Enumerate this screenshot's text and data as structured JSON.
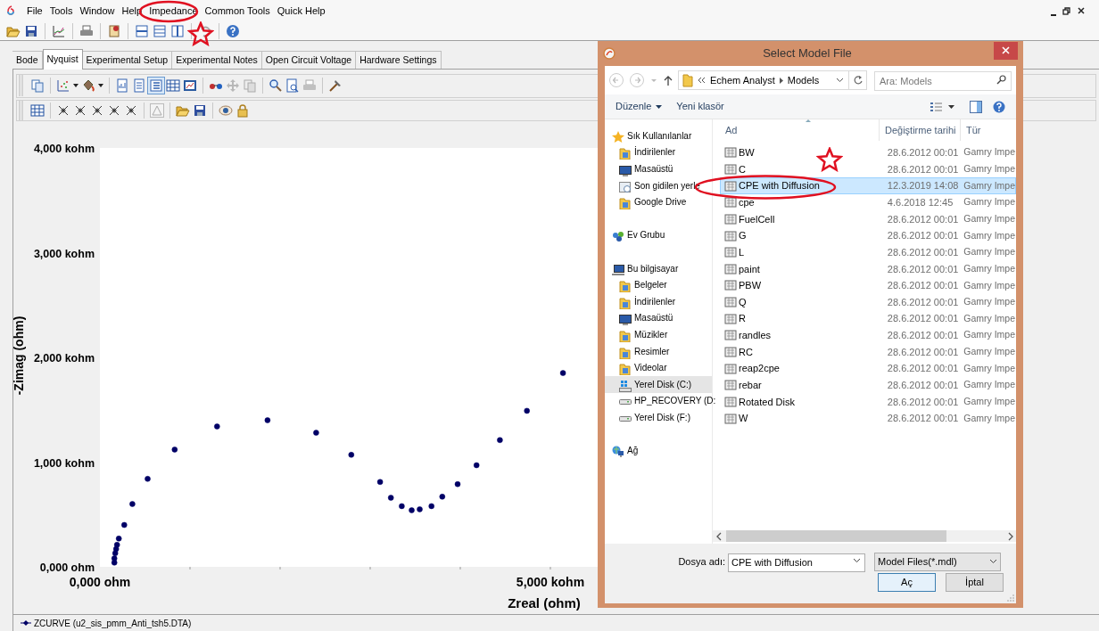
{
  "menu_bar": {
    "items": [
      "File",
      "Tools",
      "Window",
      "Help",
      "Impedance",
      "Common Tools",
      "Quick Help"
    ]
  },
  "tabs": [
    {
      "label": "Bode",
      "selected": false
    },
    {
      "label": "Nyquist",
      "selected": true
    },
    {
      "label": "Experimental Setup",
      "selected": false
    },
    {
      "label": "Experimental Notes",
      "selected": false
    },
    {
      "label": "Open Circuit Voltage",
      "selected": false
    },
    {
      "label": "Hardware Settings",
      "selected": false
    }
  ],
  "chart": {
    "chart_data": {
      "type": "scatter",
      "xlabel": "Zreal (ohm)",
      "ylabel": "-Zimag (ohm)",
      "x": [
        0.16,
        0.16,
        0.17,
        0.18,
        0.19,
        0.21,
        0.27,
        0.36,
        0.53,
        0.83,
        1.3,
        1.86,
        2.4,
        2.79,
        3.11,
        3.23,
        3.35,
        3.46,
        3.55,
        3.68,
        3.8,
        3.97,
        4.18,
        4.44,
        4.74,
        5.14
      ],
      "series": [
        {
          "name": "ZCURVE (u2_sis_pmm_Anti_tsh5.DTA)",
          "color": "#000066",
          "values": [
            0.04,
            0.08,
            0.13,
            0.17,
            0.21,
            0.27,
            0.4,
            0.6,
            0.84,
            1.12,
            1.34,
            1.4,
            1.28,
            1.07,
            0.81,
            0.66,
            0.58,
            0.54,
            0.55,
            0.58,
            0.67,
            0.79,
            0.97,
            1.21,
            1.49,
            1.85
          ]
        }
      ],
      "xlim": [
        0,
        10
      ],
      "ylim": [
        0,
        4
      ],
      "xticks": [
        {
          "value": 0,
          "label": "0,000 ohm"
        },
        {
          "value": 5,
          "label": "5,000 kohm"
        }
      ],
      "yticks": [
        {
          "value": 0,
          "label": "0,000 ohm"
        },
        {
          "value": 1,
          "label": "1,000 kohm"
        },
        {
          "value": 2,
          "label": "2,000 kohm"
        },
        {
          "value": 3,
          "label": "3,000 kohm"
        },
        {
          "value": 4,
          "label": "4,000 kohm"
        }
      ]
    }
  },
  "dialog": {
    "title": "Select Model File",
    "address": [
      "Echem Analyst",
      "Models"
    ],
    "search": {
      "placeholder": "Ara: Models"
    },
    "commands": [
      "Düzenle",
      "Yeni klasör"
    ],
    "nav": [
      {
        "label": "Sık Kullanılanlar",
        "kind": "favorites",
        "selected": false,
        "children": [
          {
            "label": "İndirilenler",
            "kind": "folder",
            "selected": false
          },
          {
            "label": "Masaüstü",
            "kind": "desktop",
            "selected": false
          },
          {
            "label": "Son gidilen yerle",
            "kind": "recent",
            "selected": false
          },
          {
            "label": "Google Drive",
            "kind": "folder",
            "selected": false
          }
        ]
      },
      {
        "label": "Ev Grubu",
        "kind": "homegroup",
        "selected": false
      },
      {
        "label": "Bu bilgisayar",
        "kind": "computer",
        "selected": false,
        "children": [
          {
            "label": "Belgeler",
            "kind": "folder",
            "selected": false
          },
          {
            "label": "İndirilenler",
            "kind": "folder",
            "selected": false
          },
          {
            "label": "Masaüstü",
            "kind": "desktop",
            "selected": false
          },
          {
            "label": "Müzikler",
            "kind": "folder",
            "selected": false
          },
          {
            "label": "Resimler",
            "kind": "folder",
            "selected": false
          },
          {
            "label": "Videolar",
            "kind": "folder",
            "selected": false
          },
          {
            "label": "Yerel Disk (C:)",
            "kind": "system-drive",
            "selected": true
          },
          {
            "label": "HP_RECOVERY (D:",
            "kind": "drive",
            "selected": false
          },
          {
            "label": "Yerel Disk (F:)",
            "kind": "drive",
            "selected": false
          }
        ]
      },
      {
        "label": "Ağ",
        "kind": "network",
        "selected": false
      }
    ],
    "columns": [
      "Ad",
      "Değiştirme tarihi",
      "Tür"
    ],
    "rows": [
      {
        "name": "BW",
        "modified": "28.6.2012 00:01",
        "type": "Gamry Impe",
        "selected": false
      },
      {
        "name": "C",
        "modified": "28.6.2012 00:01",
        "type": "Gamry Impe",
        "selected": false
      },
      {
        "name": "CPE with Diffusion",
        "modified": "12.3.2019 14:08",
        "type": "Gamry Impe",
        "selected": true
      },
      {
        "name": "cpe",
        "modified": "4.6.2018 12:45",
        "type": "Gamry Impe",
        "selected": false
      },
      {
        "name": "FuelCell",
        "modified": "28.6.2012 00:01",
        "type": "Gamry Impe",
        "selected": false
      },
      {
        "name": "G",
        "modified": "28.6.2012 00:01",
        "type": "Gamry Impe",
        "selected": false
      },
      {
        "name": "L",
        "modified": "28.6.2012 00:01",
        "type": "Gamry Impe",
        "selected": false
      },
      {
        "name": "paint",
        "modified": "28.6.2012 00:01",
        "type": "Gamry Impe",
        "selected": false
      },
      {
        "name": "PBW",
        "modified": "28.6.2012 00:01",
        "type": "Gamry Impe",
        "selected": false
      },
      {
        "name": "Q",
        "modified": "28.6.2012 00:01",
        "type": "Gamry Impe",
        "selected": false
      },
      {
        "name": "R",
        "modified": "28.6.2012 00:01",
        "type": "Gamry Impe",
        "selected": false
      },
      {
        "name": "randles",
        "modified": "28.6.2012 00:01",
        "type": "Gamry Impe",
        "selected": false
      },
      {
        "name": "RC",
        "modified": "28.6.2012 00:01",
        "type": "Gamry Impe",
        "selected": false
      },
      {
        "name": "reap2cpe",
        "modified": "28.6.2012 00:01",
        "type": "Gamry Impe",
        "selected": false
      },
      {
        "name": "rebar",
        "modified": "28.6.2012 00:01",
        "type": "Gamry Impe",
        "selected": false
      },
      {
        "name": "Rotated Disk",
        "modified": "28.6.2012 00:01",
        "type": "Gamry Impe",
        "selected": false
      },
      {
        "name": "W",
        "modified": "28.6.2012 00:01",
        "type": "Gamry Impe",
        "selected": false
      }
    ],
    "file_name": {
      "label": "Dosya adı:",
      "value": "CPE with Diffusion"
    },
    "filter": "Model Files(*.mdl)",
    "buttons": [
      {
        "label": "Aç",
        "default": true
      },
      {
        "label": "İptal",
        "default": false
      }
    ]
  }
}
